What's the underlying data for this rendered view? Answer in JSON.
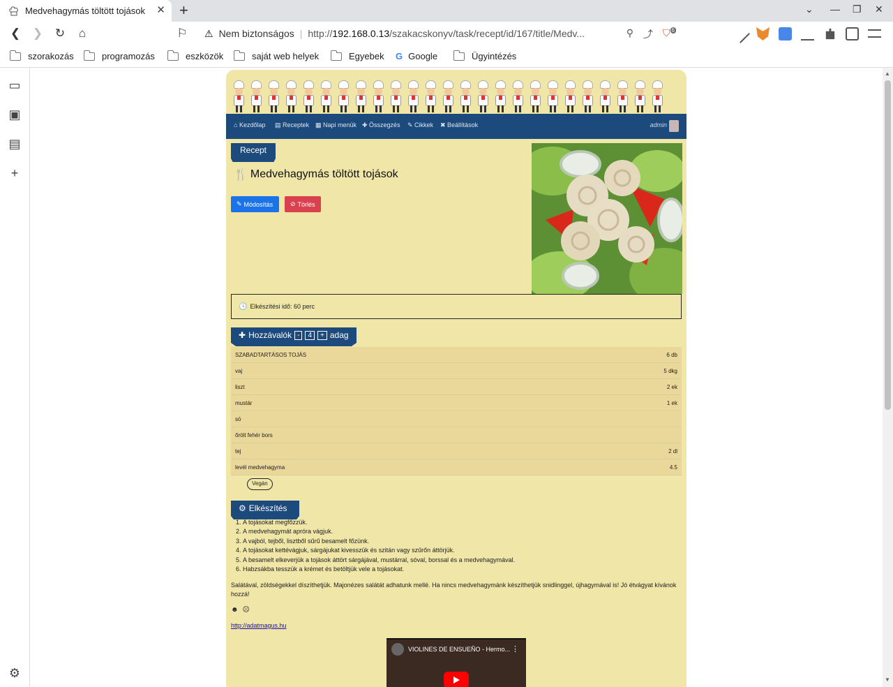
{
  "browser": {
    "tab_title": "Medvehagymás töltött tojások",
    "omnibox": {
      "insecure_label": "Nem biztonságos",
      "url_prefix": "http://",
      "url_host": "192.168.0.13",
      "url_path": "/szakacskonyv/task/recept/id/167/title/Medv..."
    },
    "brave_badge": "6",
    "bookmarks": [
      "szorakozás",
      "programozás",
      "eszközök",
      "saját web helyek",
      "Egyebek",
      "Google",
      "Ügyintézés"
    ],
    "icons": {
      "back": "back-arrow-icon",
      "forward": "forward-arrow-icon",
      "reload": "reload-icon",
      "home": "home-icon",
      "bookmark": "bookmark-icon",
      "zoom": "zoom-icon",
      "share": "share-icon"
    }
  },
  "site": {
    "nav": [
      "Kezdőlap",
      "Receptek",
      "Napi menük",
      "Összegzés",
      "Cikkek",
      "Beállítások"
    ],
    "user": "admin"
  },
  "recipe": {
    "section_label": "Recept",
    "title": "Medvehagymás töltött tojások",
    "edit_label": "Módosítás",
    "delete_label": "Törlés",
    "prep_time": "Elkészítési idő: 60 perc",
    "ingredients_label": "Hozzávalók",
    "servings_minus": "-",
    "servings": "4",
    "servings_plus": "+",
    "servings_unit": "adag",
    "ingredients": [
      {
        "name": "SZABADTARTÁSOS TOJÁS",
        "amount": "6 db"
      },
      {
        "name": "vaj",
        "amount": "5 dkg"
      },
      {
        "name": "liszt",
        "amount": "2 ek"
      },
      {
        "name": "mustár",
        "amount": "1 ek"
      },
      {
        "name": "só",
        "amount": ""
      },
      {
        "name": "őrölt fehér bors",
        "amount": ""
      },
      {
        "name": "tej",
        "amount": "2 dl"
      },
      {
        "name": "levél medvehagyma",
        "amount": "4.5"
      }
    ],
    "tag": "Vegán",
    "steps_label": "Elkészítés",
    "steps": [
      "A tojásokat megfőzzük.",
      "A medvehagymát apróra vágjuk.",
      "A vajból, tejből, lisztből sűrű besamelt főzünk.",
      "A tojásokat kettévágjuk, sárgájukat kivesszük és szitán vagy szűrőn áttörjük.",
      "A besamelt elkeverjük a tojások áttört sárgájával, mustárral, sóval, borssal és a medvehagymával.",
      "Habzsákba tesszük a krémet és betöltjük vele a tojásokat."
    ],
    "note": "Salátával, zöldségekkel díszíthetjük. Majonézes salátát adhatunk mellé. Ha nincs medvehagymánk készíthetjük snidlinggel, újhagymával is!  Jó étvágyat kívánok hozzá!",
    "link": "http://adatmagus.hu",
    "video_title": "VIOLINES DE ENSUEÑO - Hermo..."
  }
}
